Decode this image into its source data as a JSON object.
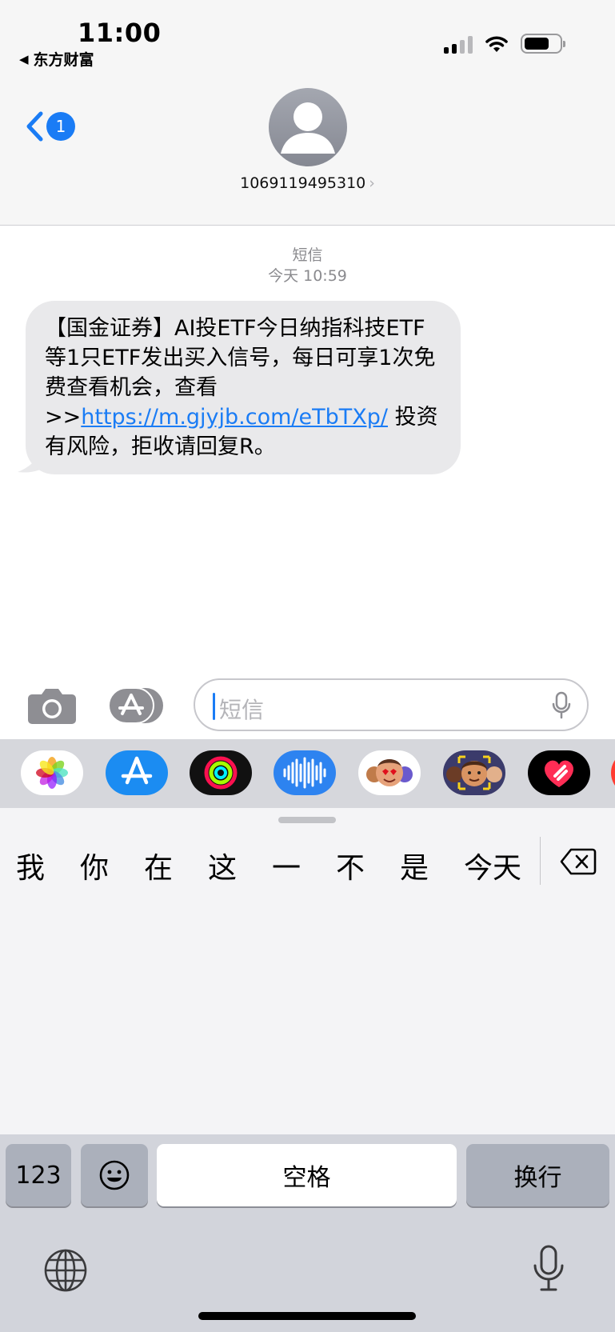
{
  "status_bar": {
    "time": "11:00",
    "back_app": "东方财富",
    "back_arrow": "◀",
    "icons": [
      "signal-icon",
      "wifi-icon",
      "battery-icon"
    ]
  },
  "nav": {
    "back_icon": "chevron-left-icon",
    "unread_count": "1",
    "contact_name": "1069119495310",
    "contact_chevron": "›"
  },
  "conversation": {
    "channel": "短信",
    "timestamp": "今天 10:59",
    "message": {
      "text_before_link": "【国金证券】AI投ETF今日纳指科技ETF等1只ETF发出买入信号，每日可享1次免费查看机会，查看>>",
      "link": "https://m.gjyjb.com/eTbTXp/",
      "text_after_link": " 投资有风险，拒收请回复R。"
    }
  },
  "composer": {
    "placeholder": "短信",
    "icons": [
      "camera-icon",
      "app-store-icon",
      "microphone-icon"
    ]
  },
  "app_strip": {
    "apps": [
      "photos-app",
      "app-store-app",
      "fitness-app",
      "audio-message-app",
      "memoji-stickers-app",
      "memoji-app",
      "digital-touch-app"
    ]
  },
  "keyboard": {
    "candidates": [
      "我",
      "你",
      "在",
      "这",
      "一",
      "不",
      "是",
      "今天"
    ],
    "keys": {
      "numbers": "123",
      "space": "空格",
      "return": "换行"
    }
  },
  "colors": {
    "accent": "#1a7cf5",
    "bubble": "#e9e9eb",
    "header_bg": "#f6f6f6",
    "keyboard_bg": "#d2d4db"
  }
}
